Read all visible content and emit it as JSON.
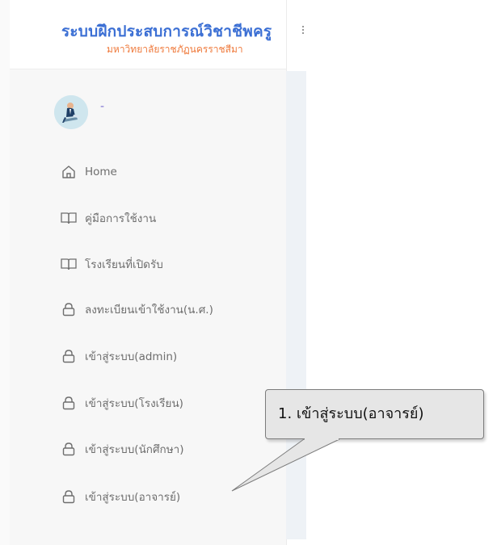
{
  "brand": {
    "title": "ระบบฝึกประสบการณ์วิชาชีพครู",
    "subtitle": "มหาวิทยาลัยราชภัฏนครราชสีมา",
    "title_color": "#3b6fd4",
    "subtitle_color": "#ef7a3c"
  },
  "user": {
    "name": "-"
  },
  "menu": {
    "items": [
      {
        "label": "Home",
        "icon": "home-icon"
      },
      {
        "label": "คู่มือการใช้งาน",
        "icon": "book-icon"
      },
      {
        "label": "โรงเรียนที่เปิดรับ",
        "icon": "book-icon"
      },
      {
        "label": "ลงทะเบียนเข้าใช้งาน(น.ศ.)",
        "icon": "lock-icon"
      },
      {
        "label": "เข้าสู่ระบบ(admin)",
        "icon": "lock-icon"
      },
      {
        "label": "เข้าสู่ระบบ(โรงเรียน)",
        "icon": "lock-icon"
      },
      {
        "label": "เข้าสู่ระบบ(นักศึกษา)",
        "icon": "lock-icon"
      },
      {
        "label": "เข้าสู่ระบบ(อาจารย์)",
        "icon": "lock-icon"
      }
    ]
  },
  "callout": {
    "text": "1. เข้าสู่ระบบ(อาจารย์)"
  },
  "colors": {
    "menu_text": "#6e6e6e",
    "sidebar_bg": "#f7f7f7"
  }
}
